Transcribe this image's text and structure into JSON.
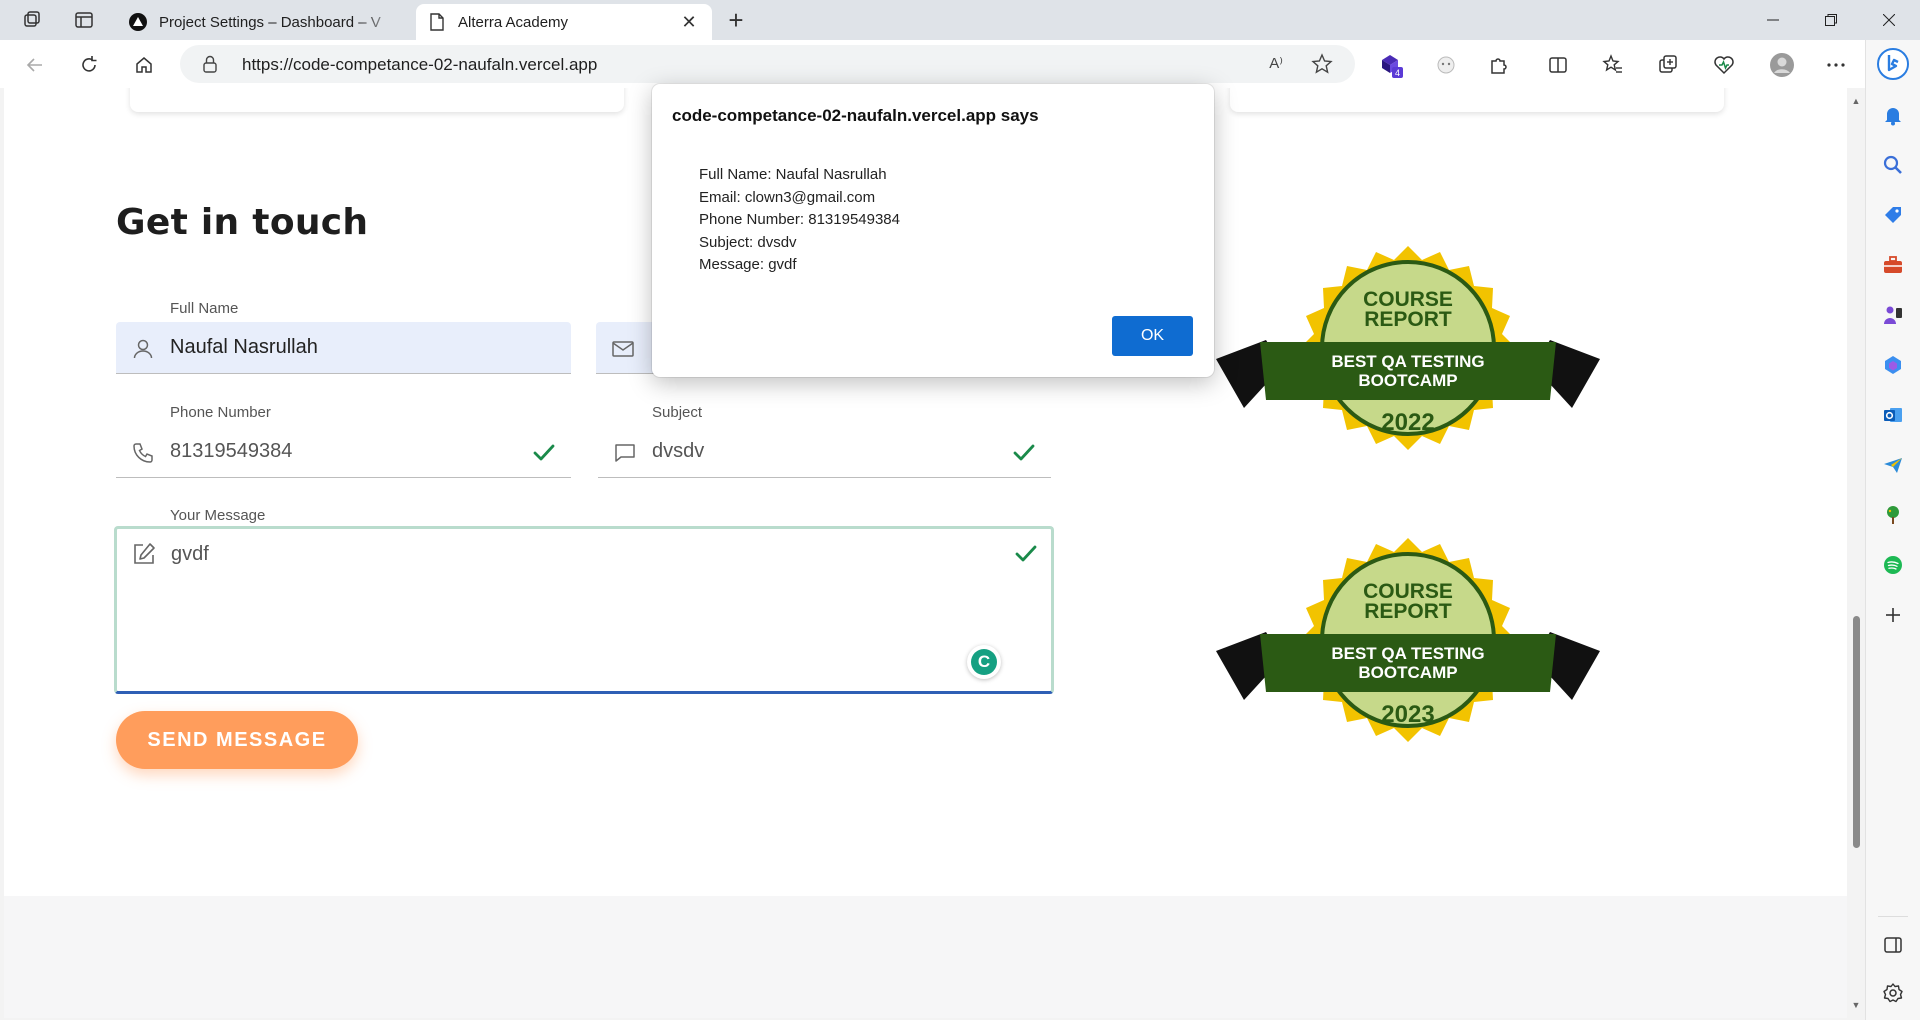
{
  "browser": {
    "tabs": [
      {
        "title": "Project Settings – Dashboard – V",
        "active": false,
        "favicon": "vercel-triangle-icon"
      },
      {
        "title": "Alterra Academy",
        "active": true,
        "favicon": "page-icon"
      }
    ],
    "url": "https://code-competance-02-naufaln.vercel.app",
    "read_aloud": "A⁾",
    "extension_badge": "4"
  },
  "form": {
    "heading": "Get in touch",
    "full_name_label": "Full Name",
    "full_name_value": "Naufal Nasrullah",
    "phone_label": "Phone Number",
    "phone_value": "81319549384",
    "subject_label": "Subject",
    "subject_value": "dvsdv",
    "message_label": "Your Message",
    "message_value": "gvdf",
    "send_label": "SEND MESSAGE"
  },
  "badges": [
    {
      "top": "COURSE",
      "top2": "REPORT",
      "ribbon1": "BEST QA TESTING",
      "ribbon2": "BOOTCAMP",
      "year": "2022"
    },
    {
      "top": "COURSE",
      "top2": "REPORT",
      "ribbon1": "BEST QA TESTING",
      "ribbon2": "BOOTCAMP",
      "year": "2023"
    }
  ],
  "dialog": {
    "title": "code-competance-02-naufaln.vercel.app says",
    "lines": [
      "Full Name: Naufal Nasrullah",
      "Email: clown3@gmail.com",
      "Phone Number: 81319549384",
      "Subject: dvsdv",
      "Message: gvdf"
    ],
    "ok_label": "OK"
  },
  "colors": {
    "accent_button": "#ff9d5c",
    "dialog_ok": "#0f6cd1",
    "check_green": "#1a8a4a",
    "badge_yellow": "#f2c300",
    "badge_green": "#2b5a14"
  }
}
